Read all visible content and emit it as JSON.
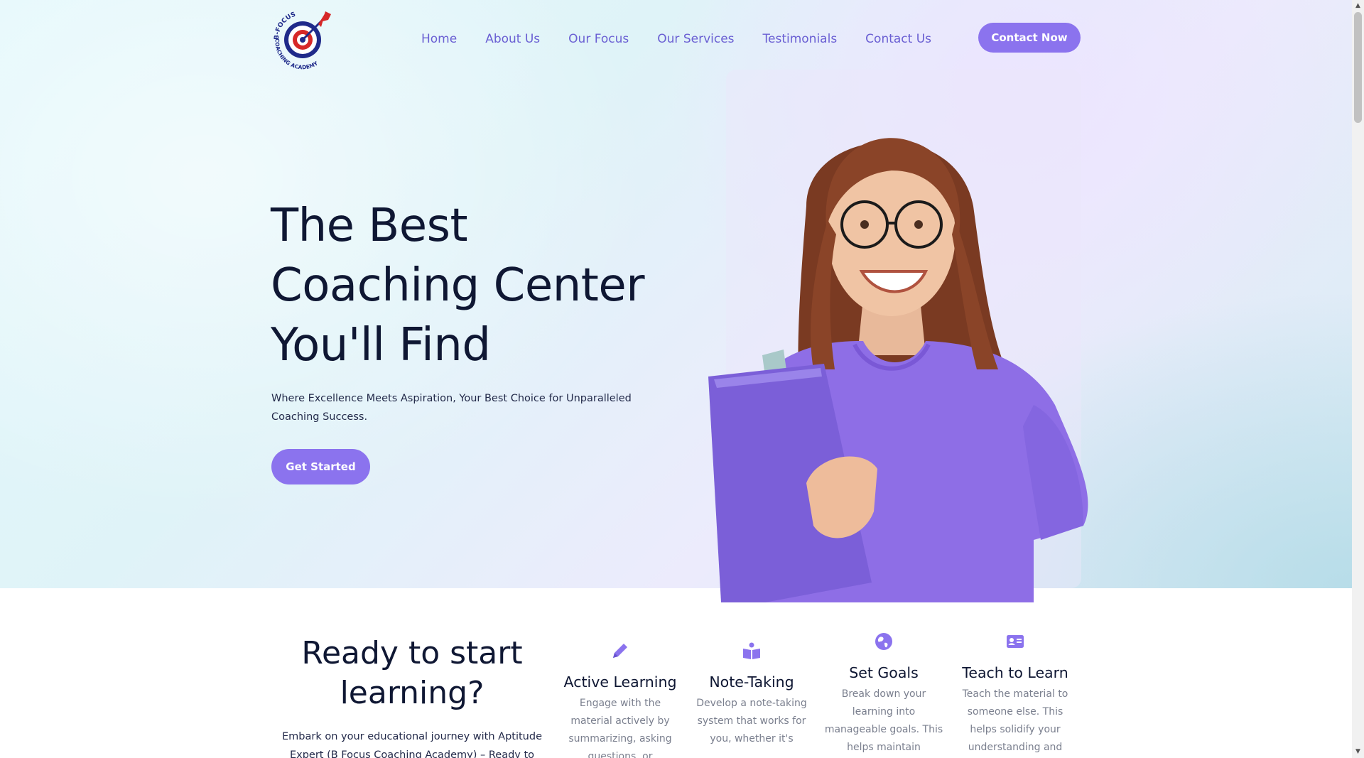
{
  "header": {
    "logo_text_top": "B-FOCUS",
    "logo_text_bottom": "COACHING ACADEMY",
    "nav": [
      "Home",
      "About Us",
      "Our Focus",
      "Our Services",
      "Testimonials",
      "Contact Us"
    ],
    "contact_label": "Contact Now"
  },
  "hero": {
    "title_lines": [
      "The Best",
      "Coaching Center",
      "You'll Find"
    ],
    "subtitle": "Where Excellence Meets Aspiration, Your Best Choice for Unparalleled Coaching Success.",
    "cta_label": "Get Started"
  },
  "ready": {
    "title": "Ready to start learning?",
    "text": "Embark on your educational journey with Aptitude Expert (B Focus Coaching Academy) – Ready to Inspire, Ready to"
  },
  "features": [
    {
      "icon": "pencil-icon",
      "title": "Active Learning",
      "text": "Engage with the material actively by summarizing, asking questions, or"
    },
    {
      "icon": "book-icon",
      "title": "Note-Taking",
      "text": "Develop a note-taking system that works for you, whether it's"
    },
    {
      "icon": "globe-icon",
      "title": "Set Goals",
      "text": "Break down your learning into manageable goals. This helps maintain motivation and provides"
    },
    {
      "icon": "id-card-icon",
      "title": "Teach to Learn",
      "text": "Teach the material to someone else. This helps solidify your understanding and"
    }
  ],
  "colors": {
    "accent": "#8b73ee",
    "nav_link": "#6a5fd3",
    "heading": "#0f1733",
    "body_text": "#232a4a",
    "muted_text": "#7a7f8e"
  }
}
